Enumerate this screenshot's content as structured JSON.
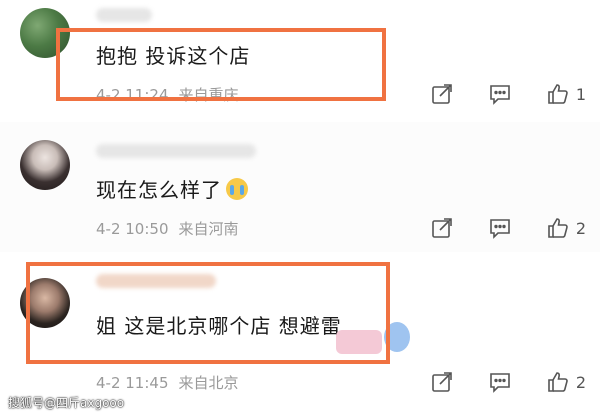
{
  "comments": [
    {
      "text": "抱抱 投诉这个店",
      "date": "4-2 11:24",
      "location": "来自重庆",
      "likes": "1"
    },
    {
      "text": "现在怎么样了",
      "date": "4-2 10:50",
      "location": "来自河南",
      "likes": "2"
    },
    {
      "text": "姐 这是北京哪个店 想避雷",
      "date": "4-2 11:45",
      "location": "来自北京",
      "likes": "2"
    }
  ],
  "icons": {
    "share": "share-icon",
    "comment": "comment-icon",
    "like": "thumbs-up-icon"
  },
  "colors": {
    "highlight": "#f07241",
    "meta_text": "#9a9a9a",
    "icon_stroke": "#555555"
  },
  "watermark": "搜狐号@四斤axgooo"
}
